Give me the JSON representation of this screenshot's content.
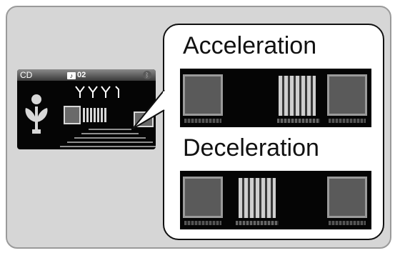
{
  "display": {
    "source_label": "CD",
    "track_number": "02",
    "track_icon": "music-note-icon",
    "status_icon": "bluetooth-icon"
  },
  "callout": {
    "acceleration_label": "Acceleration",
    "deceleration_label": "Deceleration"
  },
  "colors": {
    "frame_bg": "#d6d6d6",
    "screen_bg": "#050505",
    "callout_bg": "#ffffff"
  }
}
